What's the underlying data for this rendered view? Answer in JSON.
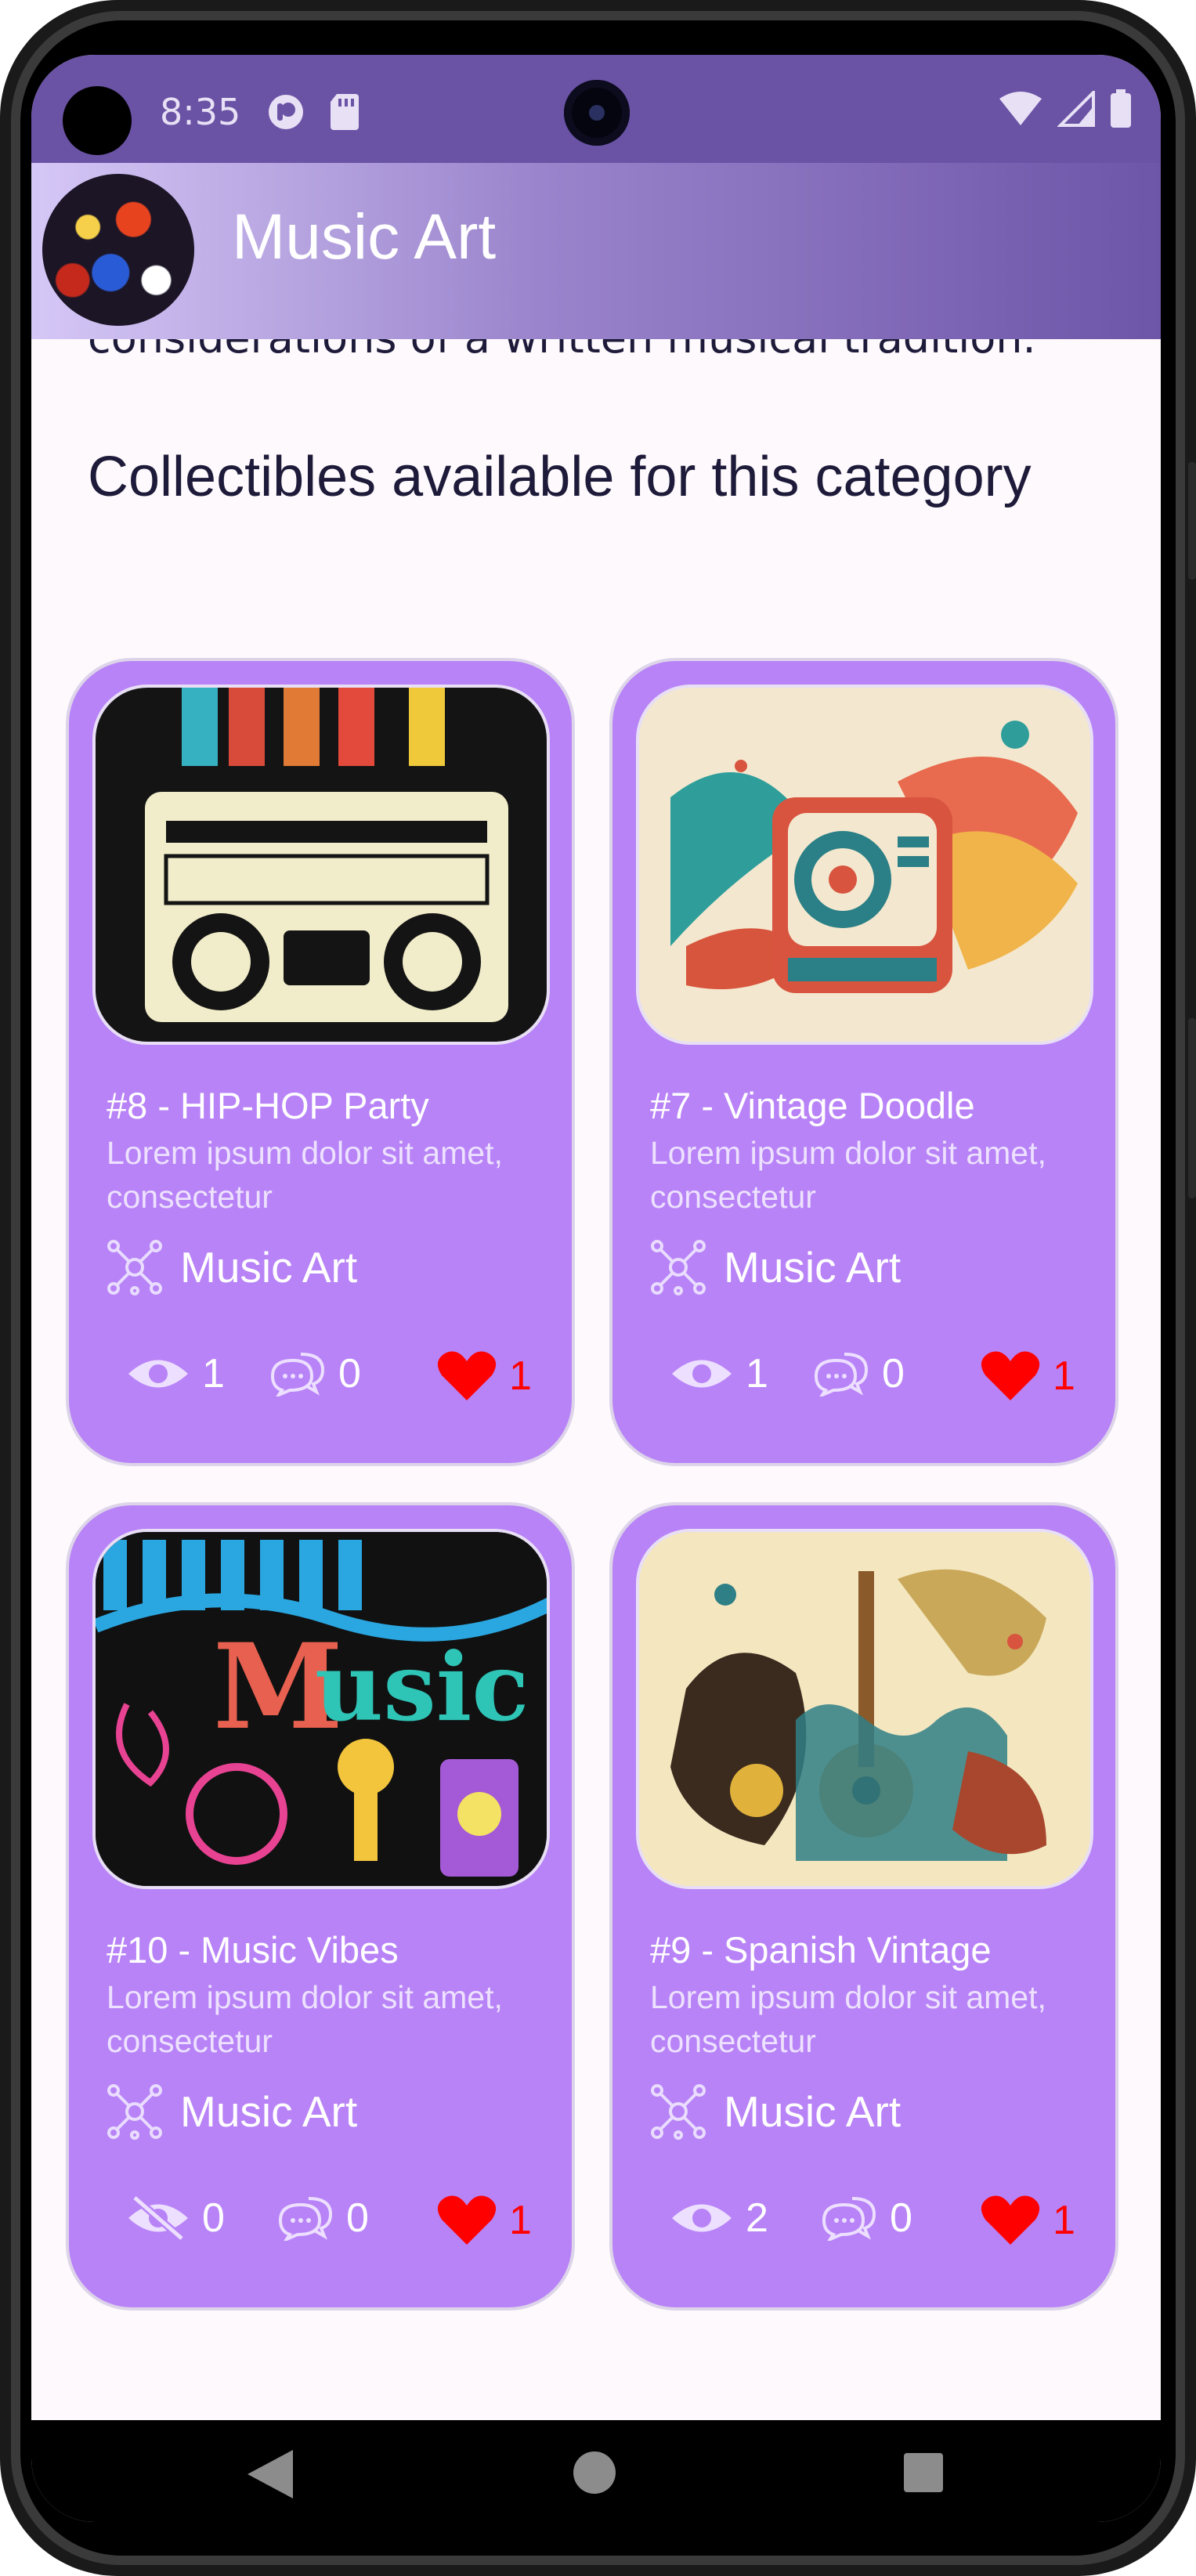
{
  "status_bar": {
    "time": "8:35"
  },
  "app_bar": {
    "title": "Music Art"
  },
  "content": {
    "clipped_text": "considerations of a written musical tradition.",
    "section_title": "Collectibles available for this category"
  },
  "cards": [
    {
      "title": "#8 - HIP-HOP Party",
      "description": "Lorem ipsum dolor sit amet, consectetur",
      "category": "Music Art",
      "views": "1",
      "comments": "0",
      "likes": "1"
    },
    {
      "title": "#7 - Vintage Doodle",
      "description": "Lorem ipsum dolor sit amet, consectetur",
      "category": "Music Art",
      "views": "1",
      "comments": "0",
      "likes": "1"
    },
    {
      "title": "#10 - Music Vibes",
      "description": "Lorem ipsum dolor sit amet, consectetur",
      "category": "Music Art",
      "views": "0",
      "comments": "0",
      "likes": "1"
    },
    {
      "title": "#9 - Spanish Vintage",
      "description": "Lorem ipsum dolor sit amet, consectetur",
      "category": "Music Art",
      "views": "2",
      "comments": "0",
      "likes": "1"
    }
  ],
  "icons": {
    "views": "eye-icon",
    "views_hidden": "eye-off-icon",
    "comments": "chat-bubbles-icon",
    "likes": "heart-icon",
    "category": "network-nodes-icon"
  },
  "colors": {
    "accent": "#b883f7",
    "like": "#ff0000",
    "app_bar": "#6a52a5"
  }
}
